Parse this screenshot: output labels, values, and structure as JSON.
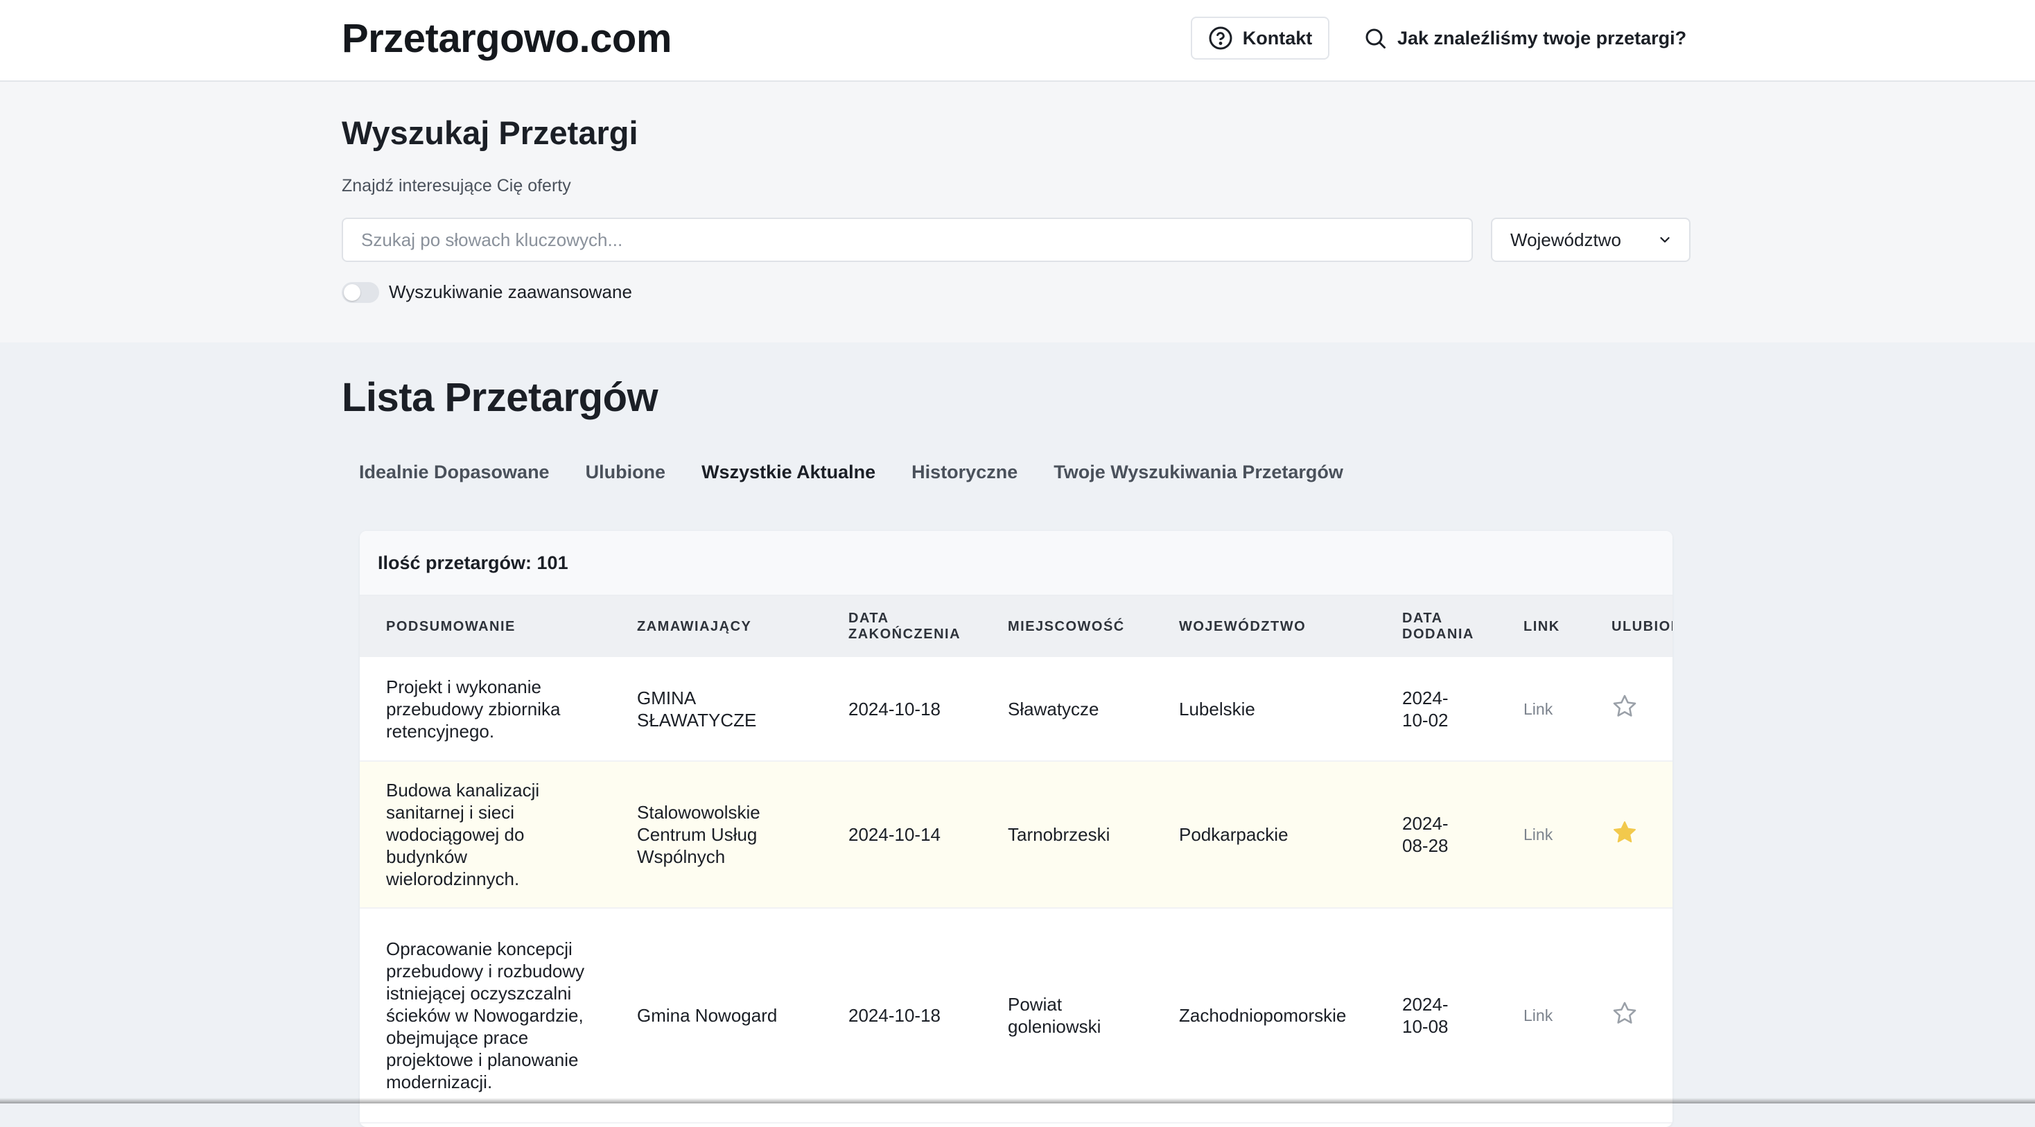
{
  "header": {
    "logo": "Przetargowo.com",
    "contact_label": "Kontakt",
    "howto_label": "Jak znaleźliśmy twoje przetargi?"
  },
  "search": {
    "title": "Wyszukaj Przetargi",
    "subtitle": "Znajdź interesujące Cię oferty",
    "placeholder": "Szukaj po słowach kluczowych...",
    "region_label": "Województwo",
    "advanced_label": "Wyszukiwanie zaawansowane",
    "advanced_enabled": false
  },
  "list": {
    "title": "Lista Przetargów",
    "tabs": [
      {
        "label": "Idealnie Dopasowane"
      },
      {
        "label": "Ulubione"
      },
      {
        "label": "Wszystkie Aktualne"
      },
      {
        "label": "Historyczne"
      },
      {
        "label": "Twoje Wyszukiwania Przetargów"
      }
    ],
    "active_tab": "Wszystkie Aktualne",
    "count_label": "Ilość przetargów: 101",
    "columns": {
      "summary": "PODSUMOWANIE",
      "client": "ZAMAWIAJĄCY",
      "end_date_1": "DATA",
      "end_date_2": "ZAKOŃCZENIA",
      "city": "MIEJSCOWOŚĆ",
      "region": "WOJEWÓDZTWO",
      "added_1": "DATA",
      "added_2": "DODANIA",
      "link": "LINK",
      "favorite": "ULUBIONE"
    },
    "rows": [
      {
        "summary": "Projekt i wykonanie przebudowy zbiornika retencyjnego.",
        "client": "GMINA SŁAWATYCZE",
        "end_date": "2024-10-18",
        "city": "Sławatycze",
        "region": "Lubelskie",
        "added": "2024-10-02",
        "link": "Link",
        "favorite": false
      },
      {
        "summary": "Budowa kanalizacji sanitarnej i sieci wodociągowej do budynków wielorodzinnych.",
        "client": "Stalowowolskie Centrum Usług Wspólnych",
        "end_date": "2024-10-14",
        "city": "Tarnobrzeski",
        "region": "Podkarpackie",
        "added": "2024-08-28",
        "link": "Link",
        "favorite": true
      },
      {
        "summary": "Opracowanie koncepcji przebudowy i rozbudowy istniejącej oczyszczalni ścieków w Nowogardzie, obejmujące prace projektowe i planowanie modernizacji.",
        "client": "Gmina Nowogard",
        "end_date": "2024-10-18",
        "city": "Powiat goleniowski",
        "region": "Zachodniopomorskie",
        "added": "2024-10-08",
        "link": "Link",
        "favorite": false
      }
    ]
  },
  "colors": {
    "star_active": "#f2c94c",
    "star_inactive": "#9aa0a8",
    "favorite_row_bg": "#fefdf1"
  }
}
